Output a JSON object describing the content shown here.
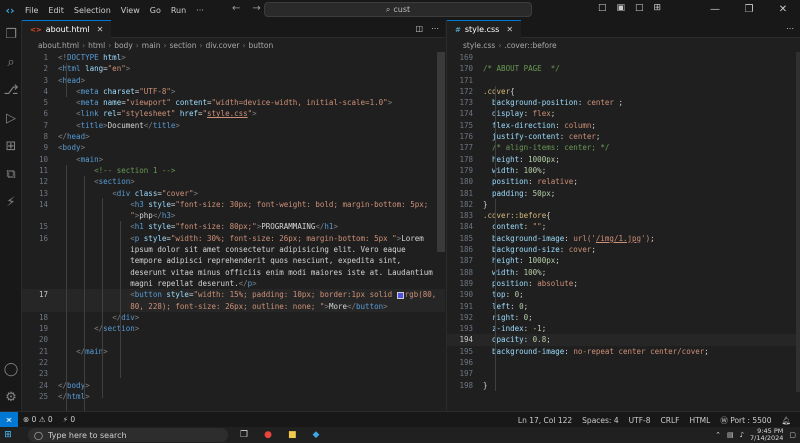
{
  "titlebar": {
    "menus": [
      "File",
      "Edit",
      "Selection",
      "View",
      "Go",
      "Run",
      "···"
    ],
    "search": "cust",
    "back": "←",
    "forward": "→"
  },
  "left_editor": {
    "tab": "about.html",
    "breadcrumb": [
      "about.html",
      "html",
      "body",
      "main",
      "section",
      "div.cover",
      "button"
    ],
    "lines": [
      {
        "n": "1",
        "html": "<span class='t-br'>&lt;!</span><span class='t-tag'>DOCTYPE</span> <span class='t-attr'>html</span><span class='t-br'>&gt;</span>"
      },
      {
        "n": "2",
        "html": "<span class='t-br'>&lt;</span><span class='t-tag'>html</span> <span class='t-attr'>lang</span>=<span class='t-str'>\"en\"</span><span class='t-br'>&gt;</span>"
      },
      {
        "n": "3",
        "html": "<span class='t-br'>&lt;</span><span class='t-tag'>head</span><span class='t-br'>&gt;</span>"
      },
      {
        "n": "4",
        "html": "    <span class='t-br'>&lt;</span><span class='t-tag'>meta</span> <span class='t-attr'>charset</span>=<span class='t-str'>\"UTF-8\"</span><span class='t-br'>&gt;</span>"
      },
      {
        "n": "5",
        "html": "    <span class='t-br'>&lt;</span><span class='t-tag'>meta</span> <span class='t-attr'>name</span>=<span class='t-str'>\"viewport\"</span> <span class='t-attr'>content</span>=<span class='t-str'>\"width=device-width, initial-scale=1.0\"</span><span class='t-br'>&gt;</span>"
      },
      {
        "n": "6",
        "html": "    <span class='t-br'>&lt;</span><span class='t-tag'>link</span> <span class='t-attr'>rel</span>=<span class='t-str'>\"stylesheet\"</span> <span class='t-attr'>href</span>=<span class='t-str'>\"<u>style.css</u>\"</span><span class='t-br'>&gt;</span>"
      },
      {
        "n": "7",
        "html": "    <span class='t-br'>&lt;</span><span class='t-tag'>title</span><span class='t-br'>&gt;</span>Document<span class='t-br'>&lt;/</span><span class='t-tag'>title</span><span class='t-br'>&gt;</span>"
      },
      {
        "n": "8",
        "html": "<span class='t-br'>&lt;/</span><span class='t-tag'>head</span><span class='t-br'>&gt;</span>"
      },
      {
        "n": "9",
        "html": "<span class='t-br'>&lt;</span><span class='t-tag'>body</span><span class='t-br'>&gt;</span>"
      },
      {
        "n": "10",
        "html": "    <span class='t-br'>&lt;</span><span class='t-tag'>main</span><span class='t-br'>&gt;</span>"
      },
      {
        "n": "11",
        "html": "        <span class='t-com'>&lt;!-- section 1 --&gt;</span>"
      },
      {
        "n": "12",
        "html": "        <span class='t-br'>&lt;</span><span class='t-tag'>section</span><span class='t-br'>&gt;</span>"
      },
      {
        "n": "13",
        "html": "            <span class='t-br'>&lt;</span><span class='t-tag'>div</span> <span class='t-attr'>class</span>=<span class='t-str'>\"cover\"</span><span class='t-br'>&gt;</span>"
      },
      {
        "n": "14",
        "rows": 2,
        "html": "                <span class='t-br'>&lt;</span><span class='t-tag'>h3</span> <span class='t-attr'>style</span>=<span class='t-str'>\"font-size: 30px; font-weight: bold; margin-bottom: 5px;\n                \"</span><span class='t-br'>&gt;</span>php<span class='t-br'>&lt;/</span><span class='t-tag'>h3</span><span class='t-br'>&gt;</span>"
      },
      {
        "n": "15",
        "html": "                <span class='t-br'>&lt;</span><span class='t-tag'>h1</span> <span class='t-attr'>style</span>=<span class='t-str'>\"font-size: 80px;\"</span><span class='t-br'>&gt;</span>PROGRAMMAING<span class='t-br'>&lt;/</span><span class='t-tag'>h1</span><span class='t-br'>&gt;</span>"
      },
      {
        "n": "16",
        "rows": 5,
        "html": "                <span class='t-br'>&lt;</span><span class='t-tag'>p</span> <span class='t-attr'>style</span>=<span class='t-str'>\"width: 30%; font-size: 26px; margin-bottom: 5px \"</span><span class='t-br'>&gt;</span>Lorem\n                ipsum dolor sit amet consectetur adipisicing elit. Vero eaque\n                tempore adipisci reprehenderit quos nesciunt, expedita sint,\n                deserunt vitae minus officiis enim modi maiores iste at. Laudantium\n                magni repellat deserunt.<span class='t-br'>&lt;/</span><span class='t-tag'>p</span><span class='t-br'>&gt;</span>"
      },
      {
        "n": "17",
        "rows": 2,
        "cur": true,
        "html": "                <span class='t-br'>&lt;</span><span class='t-tag'>button</span> <span class='t-attr'>style</span>=<span class='t-str'>\"width: 15%; padding: 10px; border:1px solid <span class='swatch'></span>rgb(80,\n                80, 228); font-size: 26px; outline: none; \"</span><span class='t-br'>&gt;</span>More<span class='t-br'>&lt;/</span><span class='t-tag'>button</span><span class='t-br'>&gt;</span>"
      },
      {
        "n": "18",
        "html": "            <span class='t-br'>&lt;/</span><span class='t-tag'>div</span><span class='t-br'>&gt;</span>"
      },
      {
        "n": "19",
        "html": "        <span class='t-br'>&lt;/</span><span class='t-tag'>section</span><span class='t-br'>&gt;</span>"
      },
      {
        "n": "20",
        "html": ""
      },
      {
        "n": "21",
        "html": "    <span class='t-br'>&lt;/</span><span class='t-tag'>main</span><span class='t-br'>&gt;</span>"
      },
      {
        "n": "22",
        "html": ""
      },
      {
        "n": "23",
        "html": ""
      },
      {
        "n": "24",
        "html": "<span class='t-br'>&lt;/</span><span class='t-tag'>body</span><span class='t-br'>&gt;</span>"
      },
      {
        "n": "25",
        "html": "<span class='t-br'>&lt;/</span><span class='t-tag'>html</span><span class='t-br'>&gt;</span>"
      }
    ]
  },
  "right_editor": {
    "tab": "style.css",
    "breadcrumb": [
      "style.css",
      ".cover::before"
    ],
    "lines": [
      {
        "n": "169",
        "html": ""
      },
      {
        "n": "170",
        "html": "<span class='t-com'>/* ABOUT PAGE  */</span>"
      },
      {
        "n": "171",
        "html": ""
      },
      {
        "n": "172",
        "html": "<span class='t-sel'>.cover</span>{"
      },
      {
        "n": "173",
        "html": "  <span class='t-prop'>background-position</span>: <span class='t-val'>center</span> ;"
      },
      {
        "n": "174",
        "html": "  <span class='t-prop'>display</span>: <span class='t-val'>flex</span>;"
      },
      {
        "n": "175",
        "html": "  <span class='t-prop'>flex-direction</span>: <span class='t-val'>column</span>;"
      },
      {
        "n": "176",
        "html": "  <span class='t-prop'>justify-content</span>: <span class='t-val'>center</span>;"
      },
      {
        "n": "177",
        "html": "  <span class='t-com'>/* align-items: center; */</span>"
      },
      {
        "n": "178",
        "html": "  <span class='t-prop'>height</span>: <span class='t-num'>1000px</span>;"
      },
      {
        "n": "179",
        "html": "  <span class='t-prop'>width</span>: <span class='t-num'>100%</span>;"
      },
      {
        "n": "180",
        "html": "  <span class='t-prop'>position</span>: <span class='t-val'>relative</span>;"
      },
      {
        "n": "181",
        "html": "  <span class='t-prop'>padding</span>: <span class='t-num'>50px</span>;"
      },
      {
        "n": "182",
        "html": "}"
      },
      {
        "n": "183",
        "html": "<span class='t-sel'>.cover::before</span>{"
      },
      {
        "n": "184",
        "html": "  <span class='t-prop'>content</span>: <span class='t-str'>\"\"</span>;"
      },
      {
        "n": "185",
        "html": "  <span class='t-prop'>background-image</span>: <span class='t-val'>url(</span><span class='t-str'>'<u>/img/1.jpg</u>'</span><span class='t-val'>)</span>;"
      },
      {
        "n": "186",
        "html": "  <span class='t-prop'>background-size</span>: <span class='t-val'>cover</span>;"
      },
      {
        "n": "187",
        "html": "  <span class='t-prop'>height</span>: <span class='t-num'>1000px</span>;"
      },
      {
        "n": "188",
        "html": "  <span class='t-prop'>width</span>: <span class='t-num'>100%</span>;"
      },
      {
        "n": "189",
        "html": "  <span class='t-prop'>position</span>: <span class='t-val'>absolute</span>;"
      },
      {
        "n": "190",
        "html": "  <span class='t-prop'>top</span>: <span class='t-num'>0</span>;"
      },
      {
        "n": "191",
        "html": "  <span class='t-prop'>left</span>: <span class='t-num'>0</span>;"
      },
      {
        "n": "192",
        "html": "  <span class='t-prop'>right</span>: <span class='t-num'>0</span>;"
      },
      {
        "n": "193",
        "html": "  <span class='t-prop'>z-index</span>: <span class='t-num'>-1</span>;"
      },
      {
        "n": "194",
        "cur": true,
        "html": "  <span class='t-prop'>opacity</span>: <span class='t-num'>0.8</span>;"
      },
      {
        "n": "195",
        "html": "  <span class='t-prop'>background-image</span>: <span class='t-val'>no-repeat center center/cover</span>;"
      },
      {
        "n": "196",
        "html": ""
      },
      {
        "n": "197",
        "html": ""
      },
      {
        "n": "198",
        "html": "}"
      }
    ]
  },
  "status": {
    "errors": "⊗ 0 ⚠ 0",
    "ports": "⚡ 0",
    "position": "Ln 17, Col 122",
    "spaces": "Spaces: 4",
    "encoding": "UTF-8",
    "eol": "CRLF",
    "language": "HTML",
    "port": "Ⓦ Port : 5500"
  },
  "taskbar": {
    "search_placeholder": "Type here to search",
    "time": "9:45 PM",
    "date": "7/14/2024"
  },
  "colors": {
    "accent": "#0078d4",
    "editor_bg": "#1f1f1f",
    "chrome_bg": "#181818"
  }
}
